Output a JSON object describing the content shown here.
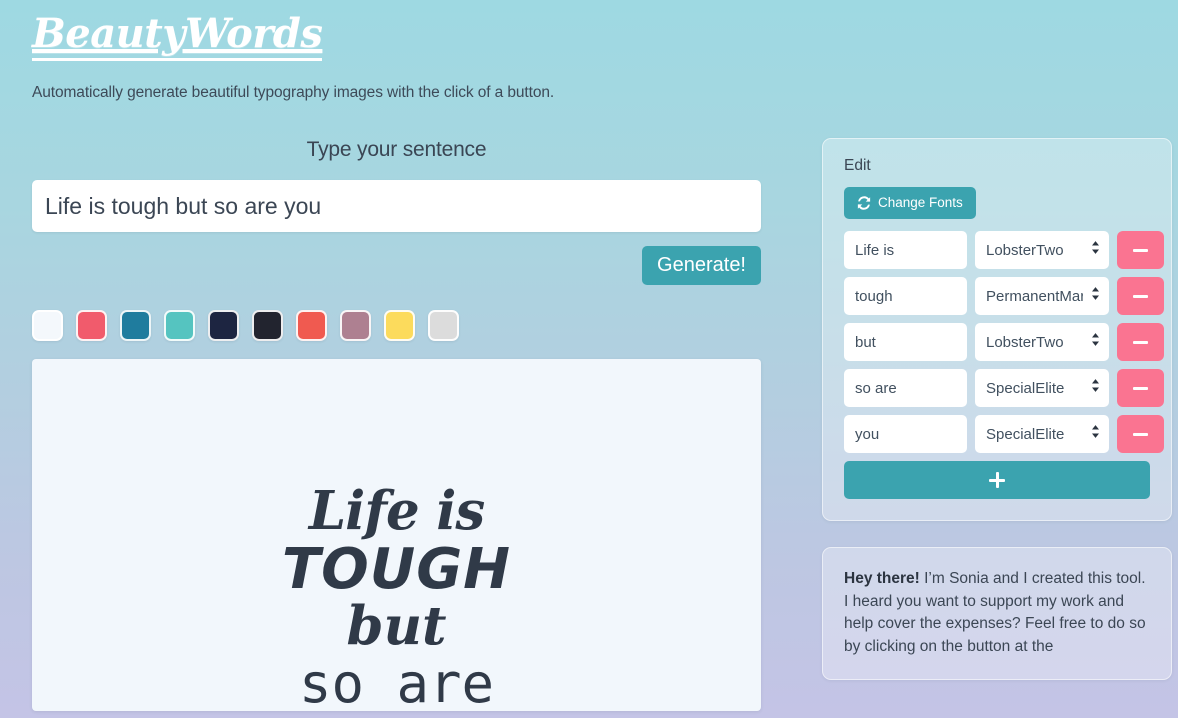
{
  "header": {
    "brand_title": "BeautyWords",
    "tagline": "Automatically generate beautiful typography images with the click of a button."
  },
  "sentence": {
    "label": "Type your sentence",
    "value": "Life is tough but so are you",
    "placeholder": "Type your sentence",
    "generate_label": "Generate!"
  },
  "palette": {
    "swatches": [
      {
        "name": "off-white",
        "color": "#F4F8FC"
      },
      {
        "name": "coral-pink",
        "color": "#F15B6C"
      },
      {
        "name": "teal-blue",
        "color": "#1F7C9E"
      },
      {
        "name": "turquoise",
        "color": "#55C4C0"
      },
      {
        "name": "navy",
        "color": "#1D2541"
      },
      {
        "name": "near-black",
        "color": "#22242F"
      },
      {
        "name": "red-coral",
        "color": "#F05A50"
      },
      {
        "name": "dusty-rose",
        "color": "#AE8091"
      },
      {
        "name": "yellow",
        "color": "#FCDB5C"
      },
      {
        "name": "light-grey",
        "color": "#DCDCDC"
      }
    ]
  },
  "preview": {
    "background": "#F2F7FC",
    "text_color": "#303a48",
    "lines": [
      {
        "text": "Life is",
        "font": "LobsterTwo"
      },
      {
        "text": "TOUGH",
        "font": "PermanentMarker"
      },
      {
        "text": "but",
        "font": "LobsterTwo"
      },
      {
        "text": "so are",
        "font": "SpecialElite"
      }
    ]
  },
  "edit_panel": {
    "title": "Edit",
    "change_fonts_label": "Change Fonts",
    "change_fonts_icon": "refresh-icon",
    "add_label": "+",
    "remove_label": "–",
    "font_options": [
      "LobsterTwo",
      "PermanentMarker",
      "SpecialElite"
    ],
    "rows": [
      {
        "word": "Life is",
        "font": "LobsterTwo"
      },
      {
        "word": "tough",
        "font": "PermanentMarker"
      },
      {
        "word": "but",
        "font": "LobsterTwo"
      },
      {
        "word": "so are",
        "font": "SpecialElite"
      },
      {
        "word": "you",
        "font": "SpecialElite"
      }
    ]
  },
  "note_panel": {
    "lead": "Hey there!",
    "body": " I’m Sonia and I created this tool. I heard you want to support my work and help cover the expenses? Feel free to do so by clicking on the button at the"
  },
  "colors": {
    "accent_teal": "#3BA3AF",
    "accent_pink": "#FA7491",
    "bg_top": "#9ED9E2",
    "bg_bottom": "#C4C4E6"
  }
}
